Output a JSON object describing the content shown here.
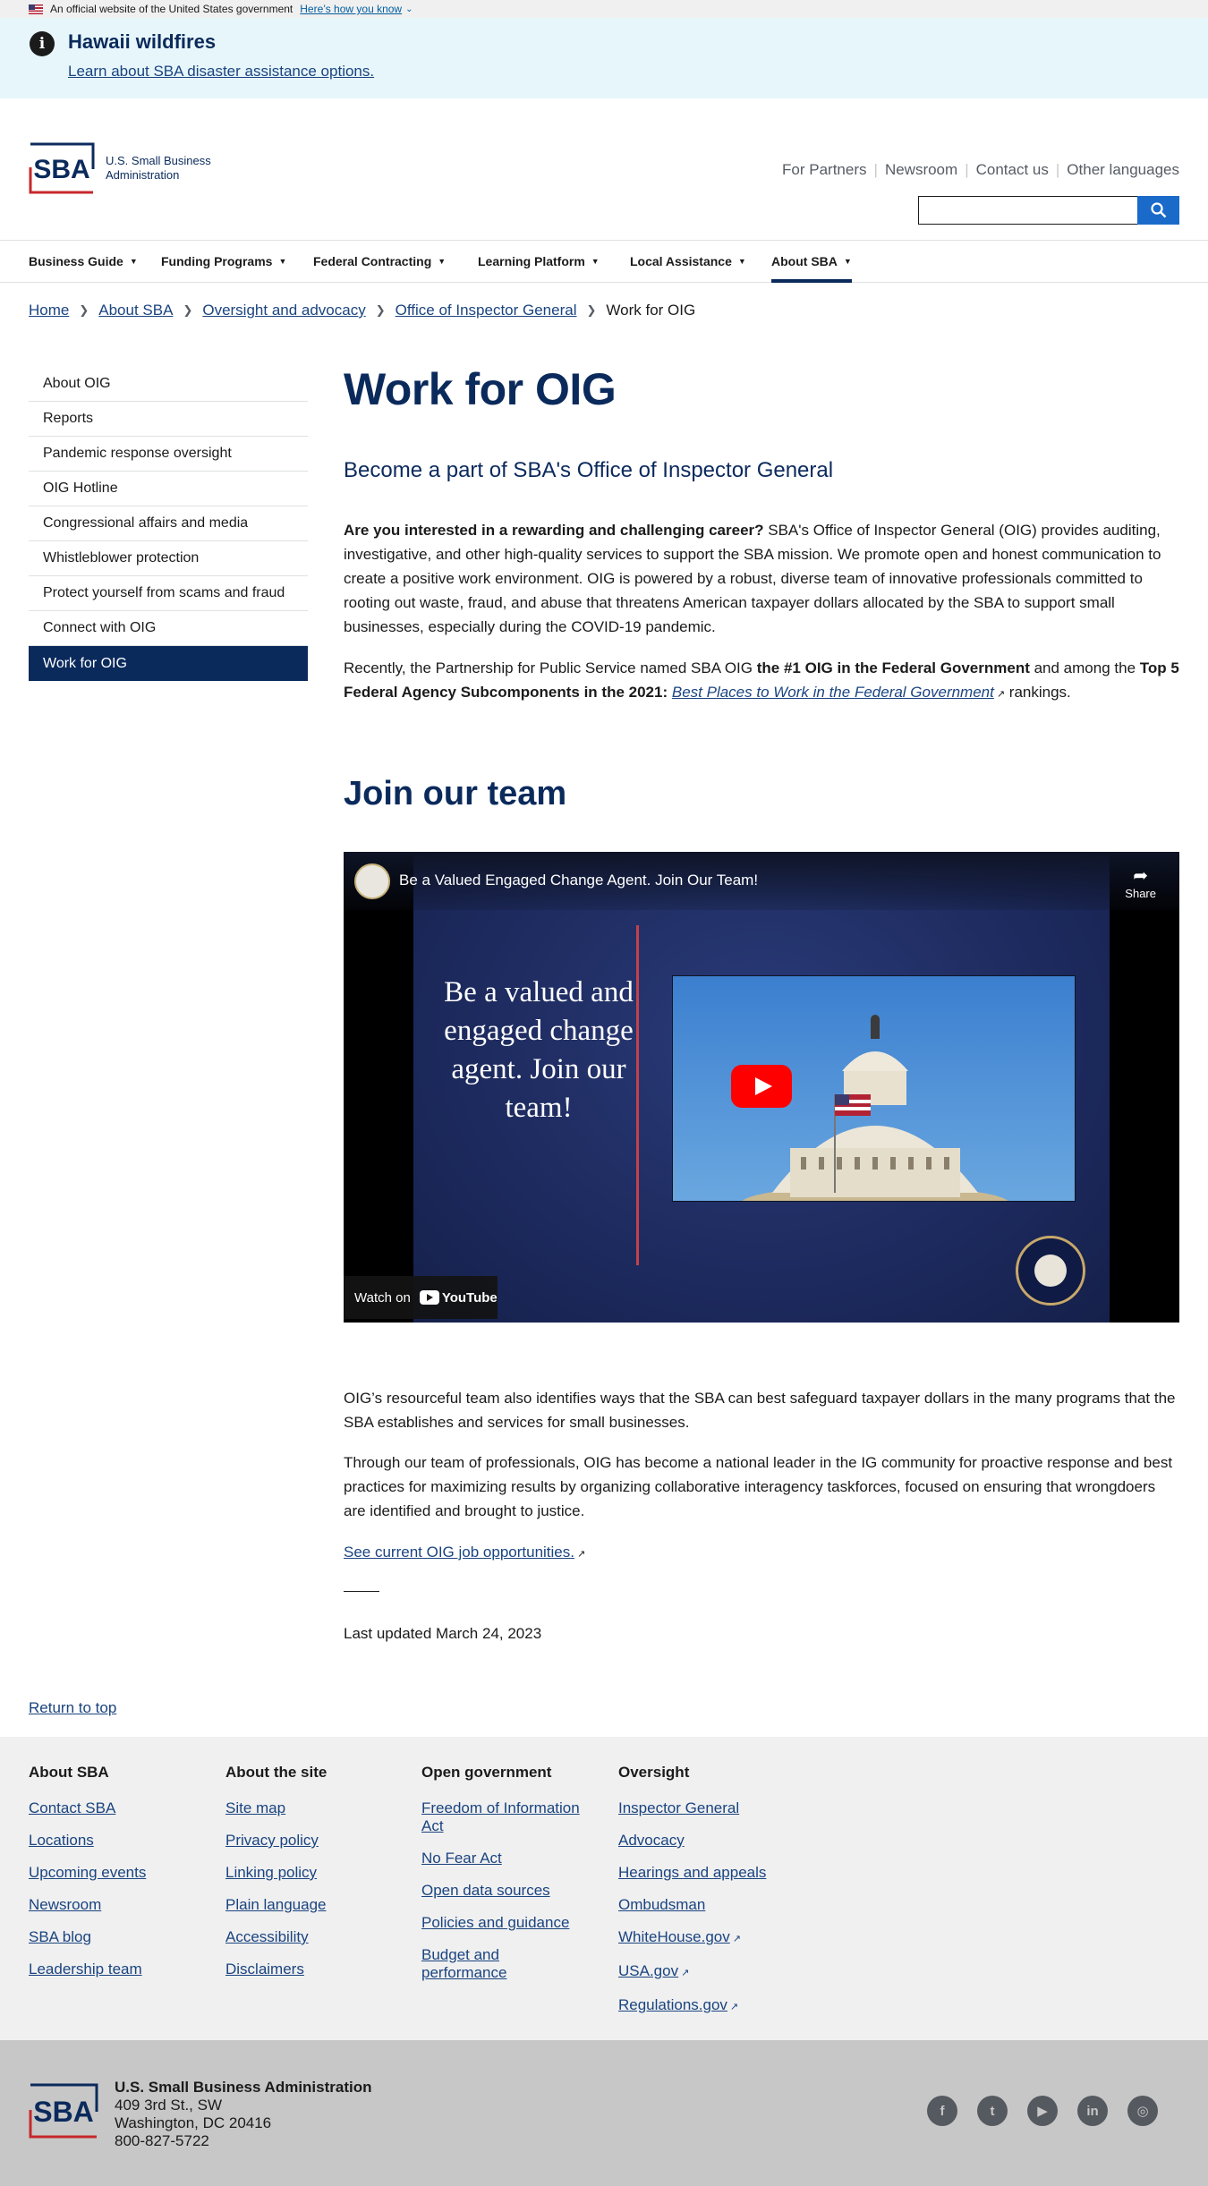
{
  "gov_banner": {
    "text": "An official website of the United States government",
    "how_link": "Here’s how you know"
  },
  "alert": {
    "title": "Hawaii wildfires",
    "link": "Learn about SBA disaster assistance options."
  },
  "header": {
    "logo_text": "SBA",
    "agency_line1": "U.S. Small Business",
    "agency_line2": "Administration",
    "utility_links": [
      "For Partners",
      "Newsroom",
      "Contact us",
      "Other languages"
    ],
    "search_placeholder": ""
  },
  "main_nav": {
    "items": [
      "Business Guide",
      "Funding Programs",
      "Federal Contracting",
      "Learning Platform",
      "Local Assistance",
      "About SBA"
    ],
    "active": "About SBA"
  },
  "breadcrumb": {
    "items": [
      "Home",
      "About SBA",
      "Oversight and advocacy",
      "Office of Inspector General"
    ],
    "current": "Work for OIG"
  },
  "sidenav": {
    "items": [
      "About OIG",
      "Reports",
      "Pandemic response oversight",
      "OIG Hotline",
      "Congressional affairs and media",
      "Whistleblower protection",
      "Protect yourself from scams and fraud",
      "Connect with OIG",
      "Work for OIG"
    ],
    "active": "Work for OIG"
  },
  "content": {
    "title": "Work for OIG",
    "subhead": "Become a part of SBA's Office of Inspector General",
    "p1_bold": "Are you interested in a rewarding and challenging career?",
    "p1_text": " SBA's Office of Inspector General (OIG) provides auditing, investigative, and other high-quality services to support the SBA mission. We promote open and honest communication to create a positive work environment. OIG is powered by a robust, diverse team of innovative professionals committed to rooting out waste, fraud, and abuse that threatens American taxpayer dollars allocated by the SBA to support small businesses, especially during the COVID-19 pandemic.",
    "p2_a": "Recently, the Partnership for Public Service named SBA OIG ",
    "p2_bold1": "the #1 OIG in the Federal Government",
    "p2_b": " and among the ",
    "p2_bold2": "Top 5 Federal Agency Subcomponents in the 2021:",
    "p2_link": "Best Places to Work in the Federal Government",
    "p2_c": " rankings.",
    "h2": "Join our team",
    "video": {
      "title": "Be a Valued Engaged Change Agent. Join Our Team!",
      "share": "Share",
      "slogan": "Be a valued and engaged change agent. Join our team!",
      "watch_on": "Watch on",
      "youtube": "YouTube"
    },
    "p3": "OIG’s resourceful team also identifies ways that the SBA can best safeguard taxpayer dollars in the many programs that the SBA establishes and services for small businesses.",
    "p4": "Through our team of professionals, OIG has become a national leader in the IG community for proactive response and best practices for maximizing results by organizing collaborative interagency taskforces, focused on ensuring that wrongdoers are identified and brought to justice.",
    "jobs_link": "See current OIG job opportunities.",
    "last_updated": "Last updated March 24, 2023"
  },
  "return_to_top": "Return to top",
  "footer": {
    "columns": [
      {
        "heading": "About SBA",
        "links": [
          "Contact SBA",
          "Locations",
          "Upcoming events",
          "Newsroom",
          "SBA blog",
          "Leadership team"
        ]
      },
      {
        "heading": "About the site",
        "links": [
          "Site map",
          "Privacy policy",
          "Linking policy",
          "Plain language",
          "Accessibility",
          "Disclaimers"
        ]
      },
      {
        "heading": "Open government",
        "links": [
          "Freedom of Information Act",
          "No Fear Act",
          "Open data sources",
          "Policies and guidance",
          "Budget and performance"
        ]
      },
      {
        "heading": "Oversight",
        "links": [
          "Inspector General",
          "Advocacy",
          "Hearings and appeals",
          "Ombudsman",
          "WhiteHouse.gov",
          "USA.gov",
          "Regulations.gov"
        ]
      }
    ],
    "org_name": "U.S. Small Business Administration",
    "address1": "409 3rd St., SW",
    "address2": "Washington, DC 20416",
    "phone": "800-827-5722",
    "social": [
      "facebook-icon",
      "twitter-icon",
      "youtube-icon",
      "linkedin-icon",
      "instagram-icon"
    ]
  },
  "colors": {
    "navy": "#0b2a5c",
    "link": "#1a4480",
    "alert_bg": "#e7f6fa",
    "search_button": "#1a6ac9",
    "footer_bg": "#f0f0f0",
    "footer_bottom_bg": "#c7c7c7"
  }
}
